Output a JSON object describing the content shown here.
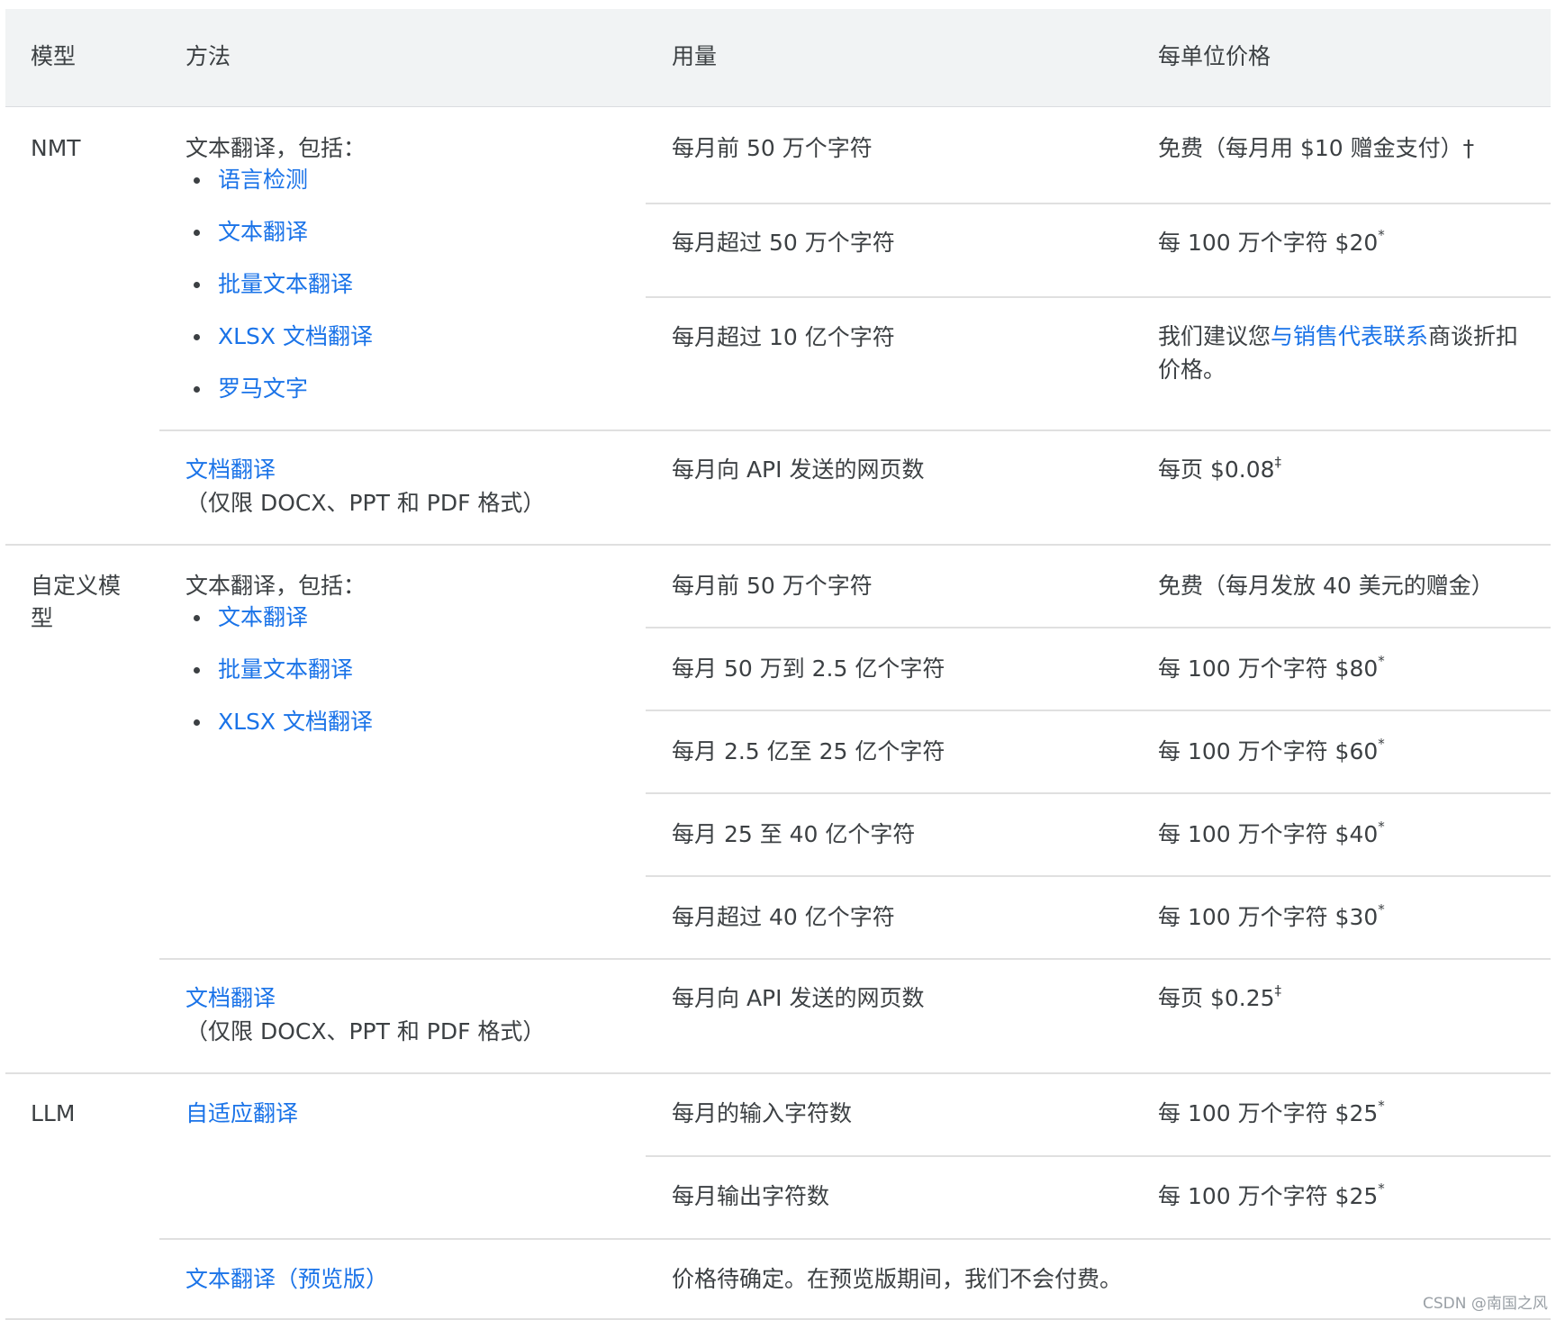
{
  "header": {
    "model": "模型",
    "method": "方法",
    "usage": "用量",
    "price": "每单位价格"
  },
  "nmt": {
    "model": "NMT",
    "method_intro": "文本翻译，包括：",
    "method_links": [
      "语言检测",
      "文本翻译",
      "批量文本翻译",
      "XLSX 文档翻译",
      "罗马文字"
    ],
    "rows": [
      {
        "usage": "每月前 50 万个字符",
        "price": "免费（每月用 $10 赠金支付）†"
      },
      {
        "usage": "每月超过 50 万个字符",
        "price": "每 100 万个字符 $20",
        "mark": "*"
      },
      {
        "usage": "每月超过 10 亿个字符",
        "price_pre": "我们建议您",
        "price_link": "与销售代表联系",
        "price_mid": "商谈折扣",
        "price_post": "价格。"
      }
    ],
    "doc": {
      "link": "文档翻译",
      "note": "（仅限 DOCX、PPT 和 PDF 格式）",
      "usage": "每月向 API 发送的网页数",
      "price": "每页 $0.08",
      "mark": "‡"
    }
  },
  "custom": {
    "model_line1": "自定义模",
    "model_line2": "型",
    "method_intro": "文本翻译，包括：",
    "method_links": [
      "文本翻译",
      "批量文本翻译",
      "XLSX 文档翻译"
    ],
    "rows": [
      {
        "usage": "每月前 50 万个字符",
        "price": "免费（每月发放 40 美元的赠金）"
      },
      {
        "usage": "每月 50 万到 2.5 亿个字符",
        "price": "每 100 万个字符 $80",
        "mark": "*"
      },
      {
        "usage": "每月 2.5 亿至 25 亿个字符",
        "price": "每 100 万个字符 $60",
        "mark": "*"
      },
      {
        "usage": "每月 25 至 40 亿个字符",
        "price": "每 100 万个字符 $40",
        "mark": "*"
      },
      {
        "usage": "每月超过 40 亿个字符",
        "price": "每 100 万个字符 $30",
        "mark": "*"
      }
    ],
    "doc": {
      "link": "文档翻译",
      "note": "（仅限 DOCX、PPT 和 PDF 格式）",
      "usage": "每月向 API 发送的网页数",
      "price": "每页 $0.25",
      "mark": "‡"
    }
  },
  "llm": {
    "model": "LLM",
    "method_link": "自适应翻译",
    "rows": [
      {
        "usage": "每月的输入字符数",
        "price": "每 100 万个字符 $25",
        "mark": "*"
      },
      {
        "usage": "每月输出字符数",
        "price": "每 100 万个字符 $25",
        "mark": "*"
      }
    ],
    "preview": {
      "link": "文本翻译",
      "link_suffix": "（预览版）",
      "usage": "价格待确定。在预览版期间，我们不会付费。"
    }
  },
  "watermark": "CSDN @南国之风",
  "colors": {
    "link": "#1a73e8",
    "text": "#3c4043",
    "header_bg": "#f1f3f4",
    "divider": "#e0e0e0"
  }
}
